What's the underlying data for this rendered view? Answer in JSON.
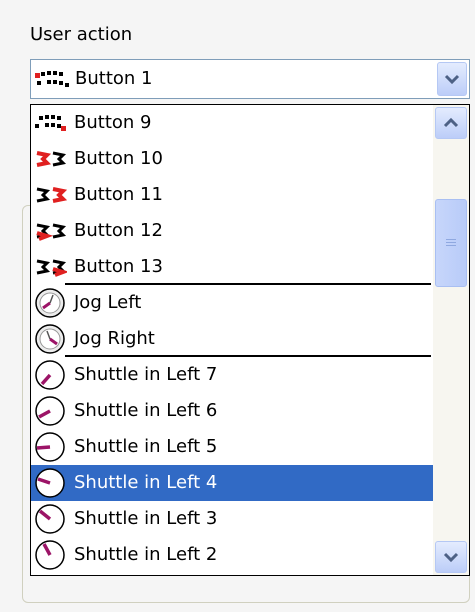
{
  "panel": {
    "label": "User action"
  },
  "combo": {
    "selected_label": "Button 1",
    "selected_icon": "button-1-dots-icon"
  },
  "list": {
    "items": [
      {
        "label": "Button 9",
        "icon": "button-9-dots-icon"
      },
      {
        "label": "Button 10",
        "icon": "button-10-pair-icon"
      },
      {
        "label": "Button 11",
        "icon": "button-11-pair-icon"
      },
      {
        "label": "Button 12",
        "icon": "button-12-pair-icon"
      },
      {
        "label": "Button 13",
        "icon": "button-13-pair-icon"
      },
      {
        "label": "Jog Left",
        "icon": "jog-left-dial-icon"
      },
      {
        "label": "Jog Right",
        "icon": "jog-right-dial-icon"
      },
      {
        "label": "Shuttle in Left 7",
        "icon": "shuttle-left-7-dial-icon"
      },
      {
        "label": "Shuttle in Left 6",
        "icon": "shuttle-left-6-dial-icon"
      },
      {
        "label": "Shuttle in Left 5",
        "icon": "shuttle-left-5-dial-icon"
      },
      {
        "label": "Shuttle in Left 4",
        "icon": "shuttle-left-4-dial-icon",
        "selected": true
      },
      {
        "label": "Shuttle in Left 3",
        "icon": "shuttle-left-3-dial-icon"
      },
      {
        "label": "Shuttle in Left 2",
        "icon": "shuttle-left-2-dial-icon"
      }
    ]
  },
  "colors": {
    "selection": "#316ac5",
    "accent_magenta": "#9c1467",
    "button_red": "#e02020",
    "scroll_arrow": "#4d6185"
  }
}
